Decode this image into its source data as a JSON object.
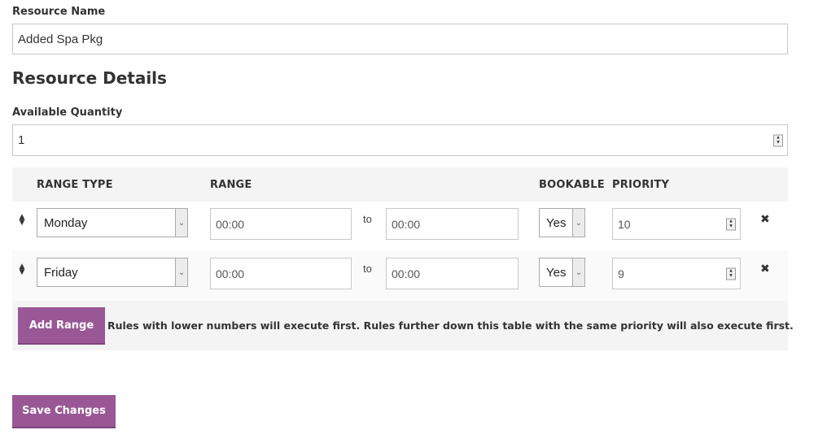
{
  "resource_name": {
    "label": "Resource Name",
    "value": "Added Spa Pkg"
  },
  "resource_details": {
    "heading": "Resource Details",
    "available_quantity_label": "Available Quantity",
    "available_quantity_value": "1"
  },
  "ranges_table": {
    "headers": {
      "range_type": "RANGE TYPE",
      "range": "RANGE",
      "bookable": "BOOKABLE",
      "priority": "PRIORITY"
    },
    "rows": [
      {
        "range_type": "Monday",
        "from": "00:00",
        "to_label": "to",
        "to": "00:00",
        "bookable": "Yes",
        "priority": "10"
      },
      {
        "range_type": "Friday",
        "from": "00:00",
        "to_label": "to",
        "to": "00:00",
        "bookable": "Yes",
        "priority": "9"
      }
    ],
    "add_range_label": "Add Range",
    "note": "Rules with lower numbers will execute first. Rules further down this table with the same priority will also execute first."
  },
  "save_label": "Save Changes",
  "icons": {
    "drag": "sort-handle-icon",
    "remove": "close-icon",
    "dropdown": "chevron-down-icon",
    "spinner": "spinner-icon"
  },
  "colors": {
    "accent": "#9a5796"
  }
}
